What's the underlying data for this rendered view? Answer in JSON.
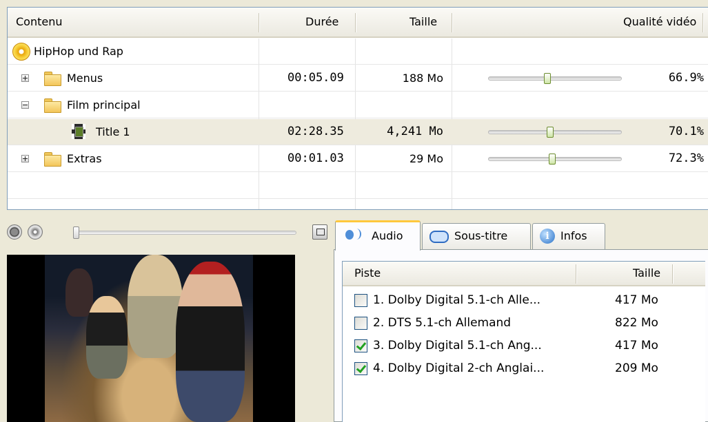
{
  "tree": {
    "columns": {
      "content": "Contenu",
      "duration": "Durée",
      "size": "Taille",
      "quality": "Qualité vidéo"
    },
    "root": {
      "label": "HipHop und Rap"
    },
    "rows": [
      {
        "label": "Menus",
        "duration": "00:05.09",
        "size": "188 Mo",
        "quality": "66.9%",
        "quality_value": 0.669,
        "expanded": false
      },
      {
        "label": "Film principal",
        "expanded": true
      },
      {
        "label": "Title 1",
        "duration": "02:28.35",
        "size": "4,241 Mo",
        "quality": "70.1%",
        "quality_value": 0.701,
        "selected": true
      },
      {
        "label": "Extras",
        "duration": "00:01.03",
        "size": "29 Mo",
        "quality": "72.3%",
        "quality_value": 0.723,
        "expanded": false
      }
    ]
  },
  "player": {
    "position": 0
  },
  "tabs": {
    "audio": "Audio",
    "subtitle": "Sous-titre",
    "info": "Infos"
  },
  "audio_list": {
    "columns": {
      "track": "Piste",
      "size": "Taille"
    },
    "rows": [
      {
        "label": "1. Dolby Digital 5.1-ch Alle...",
        "size": "417 Mo",
        "checked": false
      },
      {
        "label": "2. DTS 5.1-ch Allemand",
        "size": "822 Mo",
        "checked": false
      },
      {
        "label": "3. Dolby Digital 5.1-ch Ang...",
        "size": "417 Mo",
        "checked": true
      },
      {
        "label": "4. Dolby Digital 2-ch Anglai...",
        "size": "209 Mo",
        "checked": true
      }
    ]
  },
  "colors": {
    "selected_row": "#eeebde",
    "tab_highlight": "#ffc83c",
    "check": "#21a121"
  },
  "icons": {
    "root": "disc-icon",
    "folder": "folder-icon",
    "title": "film-icon",
    "stop": "stop-icon",
    "play": "play-icon",
    "fullscreen": "fullscreen-icon",
    "audio_tab": "audio-icon",
    "subtitle_tab": "subtitle-icon",
    "info_tab": "info-icon"
  }
}
